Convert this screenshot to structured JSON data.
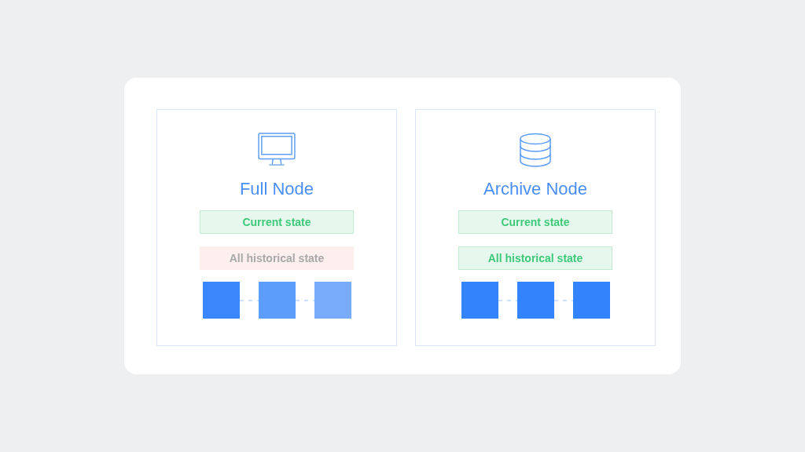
{
  "nodes": [
    {
      "kind": "monitor",
      "title": "Full Node",
      "states": [
        {
          "label": "Current state",
          "kept": true
        },
        {
          "label": "All historical state",
          "kept": false
        }
      ],
      "blocks": [
        {
          "color": "#3a86fb"
        },
        {
          "color": "#5c9cfb"
        },
        {
          "color": "#78acfa"
        }
      ]
    },
    {
      "kind": "database",
      "title": "Archive Node",
      "states": [
        {
          "label": "Current state",
          "kept": true
        },
        {
          "label": "All historical state",
          "kept": true
        }
      ],
      "blocks": [
        {
          "color": "#3384fc"
        },
        {
          "color": "#3384fc"
        },
        {
          "color": "#3384fc"
        }
      ]
    }
  ]
}
